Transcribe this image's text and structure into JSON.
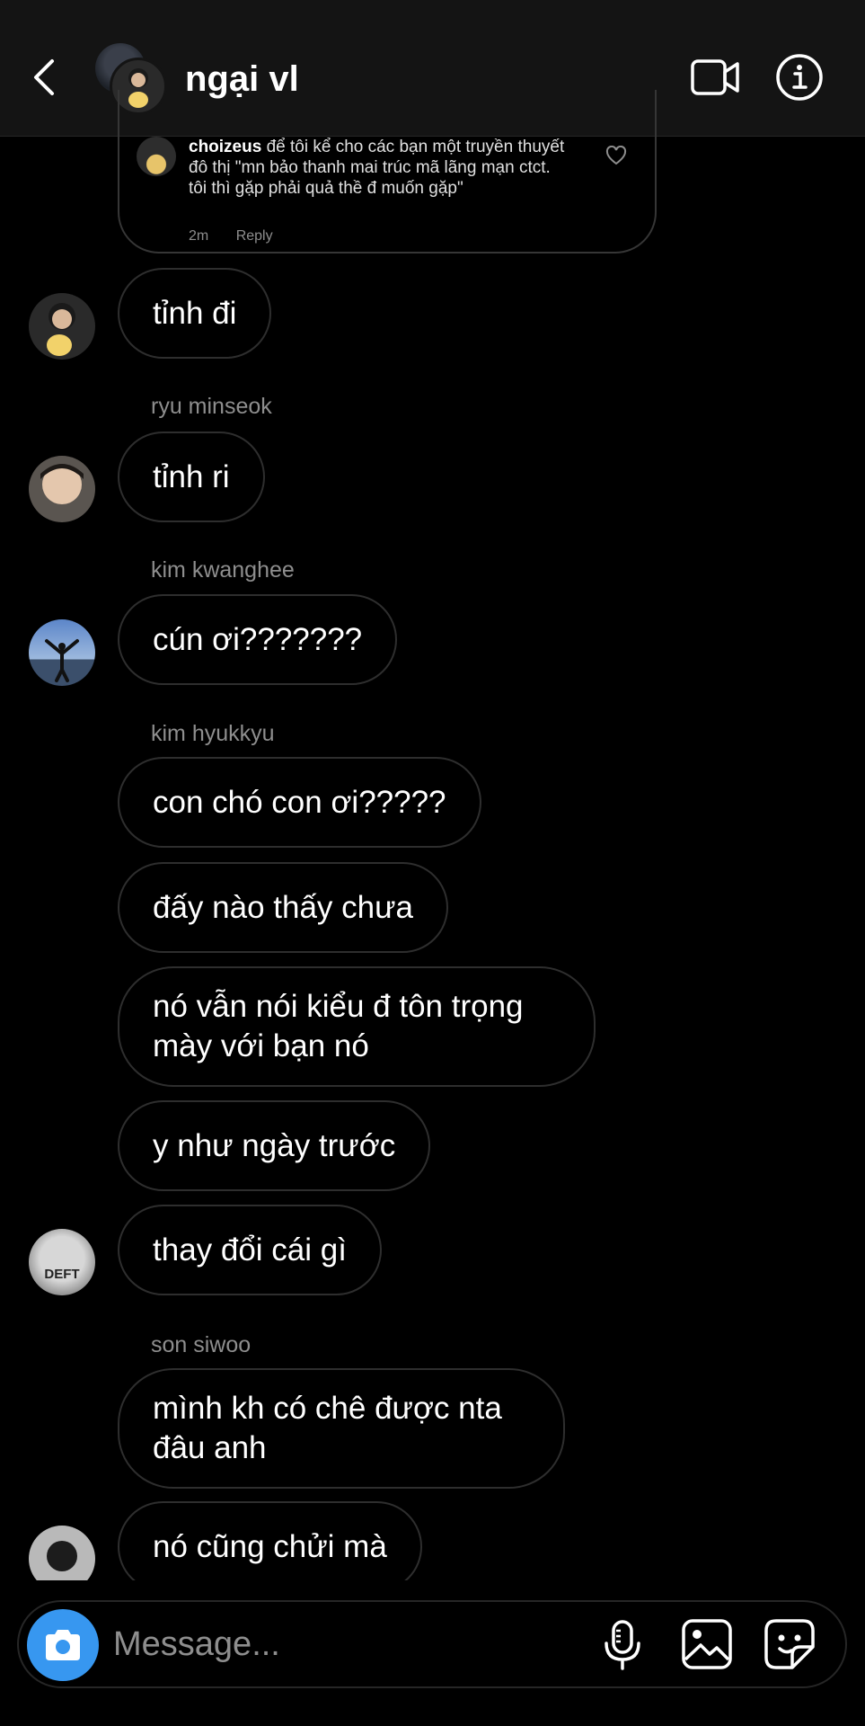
{
  "header": {
    "title": "ngại vl",
    "back_icon": "chevron-left-icon",
    "video_icon": "video-camera-icon",
    "info_icon": "info-icon"
  },
  "reply_preview": {
    "username": "choizeus",
    "text": "để tôi kể cho các bạn một truyền thuyết đô thị \"mn bảo thanh mai trúc mã lãng mạn ctct. tôi thì gặp phải quả thề đ muốn gặp\"",
    "time": "2m",
    "reply_label": "Reply"
  },
  "messages": [
    {
      "sender": "",
      "text": "tỉnh đi"
    },
    {
      "sender": "ryu minseok",
      "text": "tỉnh ri"
    },
    {
      "sender": "kim kwanghee",
      "text": "cún ơi???????"
    },
    {
      "sender": "kim hyukkyu",
      "text": "con chó con ơi?????"
    },
    {
      "sender": "",
      "text": "đấy nào thấy chưa"
    },
    {
      "sender": "",
      "text": "nó vẫn nói kiểu đ tôn trọng mày với bạn nó"
    },
    {
      "sender": "",
      "text": "y như ngày trước"
    },
    {
      "sender": "",
      "text": "thay đổi cái gì"
    },
    {
      "sender": "son siwoo",
      "text": "mình kh có chê được nta đâu anh"
    },
    {
      "sender": "",
      "text": "nó cũng chửi mà"
    }
  ],
  "avatar_labels": {
    "deft": "DEFT"
  },
  "composer": {
    "placeholder": "Message...",
    "camera_icon": "camera-icon",
    "mic_icon": "microphone-icon",
    "gallery_icon": "gallery-icon",
    "sticker_icon": "sticker-icon"
  },
  "colors": {
    "accent": "#3797f0",
    "bubble_border": "#2e2e2e",
    "header_bg": "#141414"
  }
}
